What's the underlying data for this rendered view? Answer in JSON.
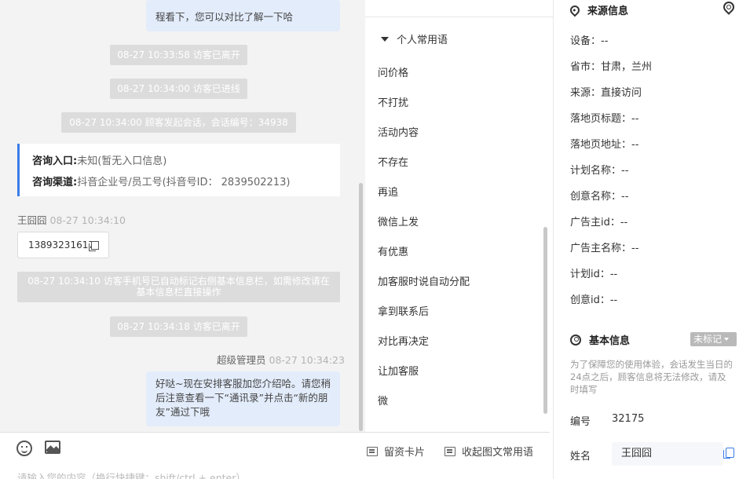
{
  "chat": {
    "top_message": "程看下，您可以对比了解一下哈",
    "system_messages": [
      "08-27 10:33:58 访客已离开",
      "08-27 10:34:00 访客已进线",
      "08-27 10:34:00 顾客发起会话，会话编号：34938"
    ],
    "info_card": {
      "entry_label": "咨询入口:",
      "entry_value": "未知(暂无入口信息)",
      "channel_label": "咨询渠道:",
      "channel_value": "抖音企业号/员工号(抖音号ID： 2839502213)"
    },
    "visitor_name": "王囧囧",
    "visitor_time": "08-27 10:34:10",
    "visitor_phone": "13893231617",
    "auto_tag_message": "08-27 10:34:10 访客手机号已自动标记右侧基本信息栏，如需修改请在基本信息栏直接操作",
    "left_message": "08-27 10:34:18 访客已离开",
    "agent_name": "超级管理员",
    "agent_time": "08-27 10:34:23",
    "agent_message": "好哒~现在安排客服加您介绍哈。请您稍后注意查看一下“通讯录”并点击“新的朋友”通过下哦"
  },
  "input": {
    "card_button": "留资卡片",
    "collapse_button": "收起图文常用语",
    "placeholder": "请输入您的内容（换行快捷键：shift/ctrl + enter）"
  },
  "phrases": {
    "header": "个人常用语",
    "items": [
      "问价格",
      "不打扰",
      "活动内容",
      "不存在",
      "再追",
      "微信上发",
      "有优惠",
      "加客服时说自动分配",
      "拿到联系后",
      "对比再决定",
      "让加客服",
      "微"
    ]
  },
  "source": {
    "title": "来源信息",
    "rows": [
      "设备：--",
      "省市：甘肃，兰州",
      "来源：直接访问",
      "落地页标题：--",
      "落地页地址：--",
      "计划名称：--",
      "创意名称：--",
      "广告主id：--",
      "广告主名称：--",
      "计划id：--",
      "创意id：--"
    ]
  },
  "basic": {
    "title": "基本信息",
    "tag_button": "未标记",
    "note": "为了保障您的使用体验，会话发生当日的24点之后，顾客信息将无法修改，请及时填写",
    "number_label": "编号",
    "number_value": "32175",
    "name_label": "姓名",
    "name_value": "王囧囧"
  },
  "colors": {
    "accent": "#3a7ce8",
    "bubble": "#e3ecfb",
    "system_bubble": "#dcdcdc"
  },
  "icons": [
    "emoji-icon",
    "image-icon",
    "card-icon",
    "collapse-icon",
    "pin-icon",
    "location-icon",
    "user-icon",
    "copy-icon",
    "edit-icon"
  ]
}
